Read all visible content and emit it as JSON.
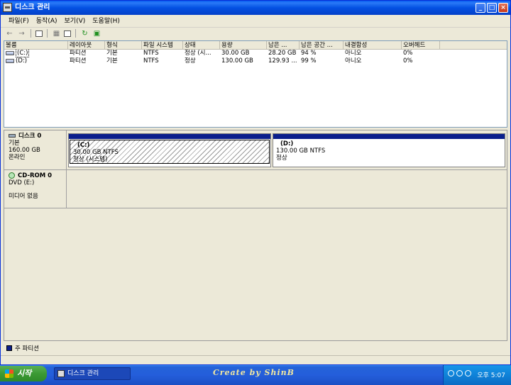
{
  "window": {
    "title": "디스크 관리",
    "buttons": {
      "minimize": "_",
      "maximize": "□",
      "close": "×"
    }
  },
  "menu": [
    "파일(F)",
    "동작(A)",
    "보기(V)",
    "도움말(H)"
  ],
  "volume_table": {
    "columns": [
      "볼륨",
      "레이아웃",
      "형식",
      "파일 시스템",
      "상태",
      "용량",
      "남은 ...",
      "남은 공간 ...",
      "내결함성",
      "오버헤드"
    ],
    "rows": [
      [
        "(C:)",
        "파티션",
        "기본",
        "NTFS",
        "정상 (시...",
        "30.00 GB",
        "28.20 GB",
        "94 %",
        "아니오",
        "0%"
      ],
      [
        "(D:)",
        "파티션",
        "기본",
        "NTFS",
        "정상",
        "130.00 GB",
        "129.93 ...",
        "99 %",
        "아니오",
        "0%"
      ]
    ]
  },
  "disks": [
    {
      "name": "디스크 0",
      "type": "기본",
      "size": "160.00 GB",
      "status": "온라인",
      "partitions": [
        {
          "label": "(C:)",
          "info": "30.00 GB NTFS",
          "status": "정상 (시스템)"
        },
        {
          "label": "(D:)",
          "info": "130.00 GB NTFS",
          "status": "정상"
        }
      ]
    }
  ],
  "cdrom": {
    "name": "CD-ROM 0",
    "type": "DVD (E:)",
    "status": "미디어 없음"
  },
  "legend": {
    "primary_partition": "주 파티션",
    "color": "#0a1e8c"
  },
  "taskbar": {
    "start": "시작",
    "task": "디스크 관리",
    "watermark": "Create by ShinB",
    "clock": "오후 5:07"
  }
}
